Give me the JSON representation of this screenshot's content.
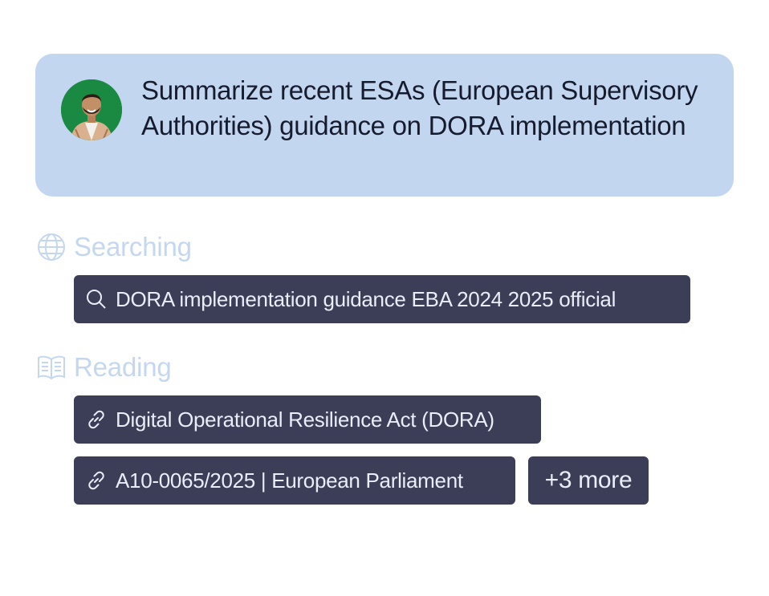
{
  "prompt": {
    "text": "Summarize recent ESAs (European Supervisory Authorities) guidance on DORA implementation",
    "avatar_icon": "user-avatar-photo"
  },
  "searching": {
    "label": "Searching",
    "icon": "globe-icon",
    "queries": [
      {
        "icon": "search-icon",
        "text": "DORA implementation guidance EBA 2024 2025 official"
      }
    ]
  },
  "reading": {
    "label": "Reading",
    "icon": "book-icon",
    "sources": [
      {
        "icon": "link-icon",
        "text": "Digital Operational Resilience Act (DORA)"
      },
      {
        "icon": "link-icon",
        "text": "A10-0065/2025 | European Parliament"
      }
    ],
    "more_label": "+3 more"
  },
  "colors": {
    "prompt_bg": "#c2d6f0",
    "chip_bg": "#3c3d56",
    "header_color": "#c5d7ef",
    "avatar_bg": "#1a8a43"
  }
}
